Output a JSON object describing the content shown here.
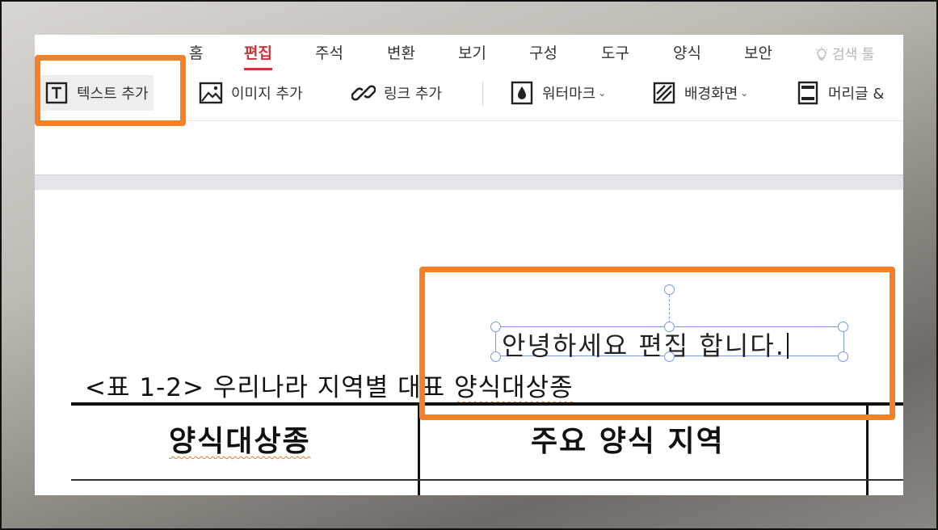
{
  "menu": {
    "tabs": [
      "홈",
      "편집",
      "주석",
      "변환",
      "보기",
      "구성",
      "도구",
      "양식",
      "보안"
    ],
    "active_tab": "편집",
    "search_label": "검색 툴"
  },
  "toolbar": {
    "add_text": "텍스트 추가",
    "add_image": "이미지 추가",
    "add_link": "링크 추가",
    "watermark": "워터마크",
    "background": "배경화면",
    "header_footer": "머리글 &"
  },
  "document": {
    "caption_prefix": "<표 1-2> 우리나라 지역별 대표 ",
    "caption_suffix": "양식대상종",
    "table_headers": [
      "양식대상종",
      "주요 양식 지역"
    ],
    "textbox_text": "안녕하세요 편집 합니다."
  },
  "colors": {
    "accent_red": "#c8353a",
    "annotation_orange": "#f5802a",
    "selection_blue": "#7a9bdc"
  },
  "icons": {
    "text": "text-box-icon",
    "image": "image-icon",
    "link": "link-icon",
    "watermark": "water-drop-icon",
    "background": "striped-square-icon",
    "header": "header-footer-icon",
    "search": "lightbulb-icon"
  }
}
